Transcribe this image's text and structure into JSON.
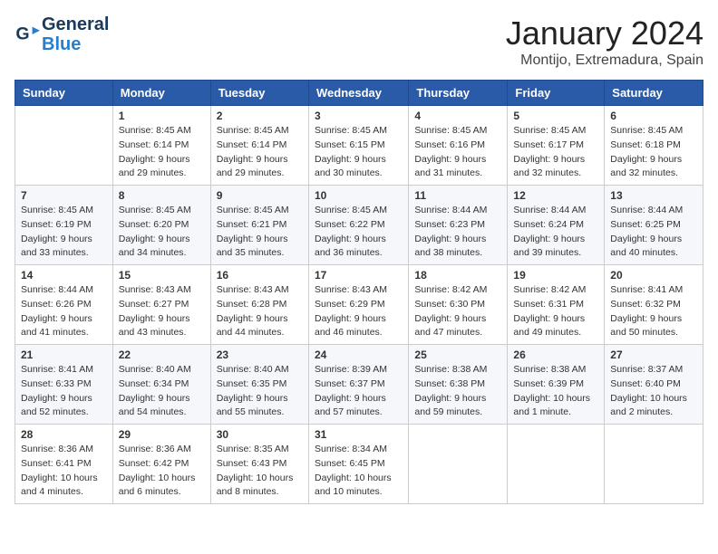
{
  "logo": {
    "line1": "General",
    "line2": "Blue"
  },
  "title": "January 2024",
  "subtitle": "Montijo, Extremadura, Spain",
  "weekdays": [
    "Sunday",
    "Monday",
    "Tuesday",
    "Wednesday",
    "Thursday",
    "Friday",
    "Saturday"
  ],
  "weeks": [
    [
      {
        "day": "",
        "info": ""
      },
      {
        "day": "1",
        "info": "Sunrise: 8:45 AM\nSunset: 6:14 PM\nDaylight: 9 hours\nand 29 minutes."
      },
      {
        "day": "2",
        "info": "Sunrise: 8:45 AM\nSunset: 6:14 PM\nDaylight: 9 hours\nand 29 minutes."
      },
      {
        "day": "3",
        "info": "Sunrise: 8:45 AM\nSunset: 6:15 PM\nDaylight: 9 hours\nand 30 minutes."
      },
      {
        "day": "4",
        "info": "Sunrise: 8:45 AM\nSunset: 6:16 PM\nDaylight: 9 hours\nand 31 minutes."
      },
      {
        "day": "5",
        "info": "Sunrise: 8:45 AM\nSunset: 6:17 PM\nDaylight: 9 hours\nand 32 minutes."
      },
      {
        "day": "6",
        "info": "Sunrise: 8:45 AM\nSunset: 6:18 PM\nDaylight: 9 hours\nand 32 minutes."
      }
    ],
    [
      {
        "day": "7",
        "info": "Sunrise: 8:45 AM\nSunset: 6:19 PM\nDaylight: 9 hours\nand 33 minutes."
      },
      {
        "day": "8",
        "info": "Sunrise: 8:45 AM\nSunset: 6:20 PM\nDaylight: 9 hours\nand 34 minutes."
      },
      {
        "day": "9",
        "info": "Sunrise: 8:45 AM\nSunset: 6:21 PM\nDaylight: 9 hours\nand 35 minutes."
      },
      {
        "day": "10",
        "info": "Sunrise: 8:45 AM\nSunset: 6:22 PM\nDaylight: 9 hours\nand 36 minutes."
      },
      {
        "day": "11",
        "info": "Sunrise: 8:44 AM\nSunset: 6:23 PM\nDaylight: 9 hours\nand 38 minutes."
      },
      {
        "day": "12",
        "info": "Sunrise: 8:44 AM\nSunset: 6:24 PM\nDaylight: 9 hours\nand 39 minutes."
      },
      {
        "day": "13",
        "info": "Sunrise: 8:44 AM\nSunset: 6:25 PM\nDaylight: 9 hours\nand 40 minutes."
      }
    ],
    [
      {
        "day": "14",
        "info": "Sunrise: 8:44 AM\nSunset: 6:26 PM\nDaylight: 9 hours\nand 41 minutes."
      },
      {
        "day": "15",
        "info": "Sunrise: 8:43 AM\nSunset: 6:27 PM\nDaylight: 9 hours\nand 43 minutes."
      },
      {
        "day": "16",
        "info": "Sunrise: 8:43 AM\nSunset: 6:28 PM\nDaylight: 9 hours\nand 44 minutes."
      },
      {
        "day": "17",
        "info": "Sunrise: 8:43 AM\nSunset: 6:29 PM\nDaylight: 9 hours\nand 46 minutes."
      },
      {
        "day": "18",
        "info": "Sunrise: 8:42 AM\nSunset: 6:30 PM\nDaylight: 9 hours\nand 47 minutes."
      },
      {
        "day": "19",
        "info": "Sunrise: 8:42 AM\nSunset: 6:31 PM\nDaylight: 9 hours\nand 49 minutes."
      },
      {
        "day": "20",
        "info": "Sunrise: 8:41 AM\nSunset: 6:32 PM\nDaylight: 9 hours\nand 50 minutes."
      }
    ],
    [
      {
        "day": "21",
        "info": "Sunrise: 8:41 AM\nSunset: 6:33 PM\nDaylight: 9 hours\nand 52 minutes."
      },
      {
        "day": "22",
        "info": "Sunrise: 8:40 AM\nSunset: 6:34 PM\nDaylight: 9 hours\nand 54 minutes."
      },
      {
        "day": "23",
        "info": "Sunrise: 8:40 AM\nSunset: 6:35 PM\nDaylight: 9 hours\nand 55 minutes."
      },
      {
        "day": "24",
        "info": "Sunrise: 8:39 AM\nSunset: 6:37 PM\nDaylight: 9 hours\nand 57 minutes."
      },
      {
        "day": "25",
        "info": "Sunrise: 8:38 AM\nSunset: 6:38 PM\nDaylight: 9 hours\nand 59 minutes."
      },
      {
        "day": "26",
        "info": "Sunrise: 8:38 AM\nSunset: 6:39 PM\nDaylight: 10 hours\nand 1 minute."
      },
      {
        "day": "27",
        "info": "Sunrise: 8:37 AM\nSunset: 6:40 PM\nDaylight: 10 hours\nand 2 minutes."
      }
    ],
    [
      {
        "day": "28",
        "info": "Sunrise: 8:36 AM\nSunset: 6:41 PM\nDaylight: 10 hours\nand 4 minutes."
      },
      {
        "day": "29",
        "info": "Sunrise: 8:36 AM\nSunset: 6:42 PM\nDaylight: 10 hours\nand 6 minutes."
      },
      {
        "day": "30",
        "info": "Sunrise: 8:35 AM\nSunset: 6:43 PM\nDaylight: 10 hours\nand 8 minutes."
      },
      {
        "day": "31",
        "info": "Sunrise: 8:34 AM\nSunset: 6:45 PM\nDaylight: 10 hours\nand 10 minutes."
      },
      {
        "day": "",
        "info": ""
      },
      {
        "day": "",
        "info": ""
      },
      {
        "day": "",
        "info": ""
      }
    ]
  ]
}
